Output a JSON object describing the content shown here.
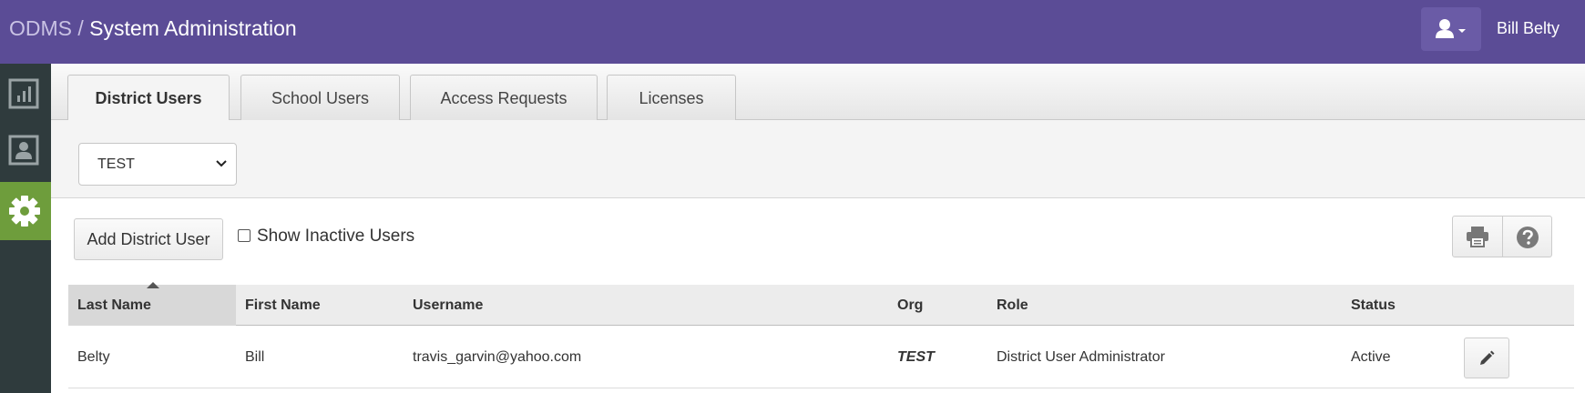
{
  "header": {
    "app": "ODMS",
    "separator": "/",
    "title": "System Administration",
    "user_menu_icon": "user-icon",
    "user_name": "Bill Belty"
  },
  "rail": {
    "items": [
      {
        "icon": "chart-icon",
        "active": false
      },
      {
        "icon": "contact-card-icon",
        "active": false
      },
      {
        "icon": "gear-icon",
        "active": true
      }
    ]
  },
  "tabs": [
    {
      "label": "District Users",
      "active": true
    },
    {
      "label": "School Users",
      "active": false
    },
    {
      "label": "Access Requests",
      "active": false
    },
    {
      "label": "Licenses",
      "active": false
    }
  ],
  "filter": {
    "district_selected": "TEST"
  },
  "toolbar": {
    "add_label": "Add District User",
    "show_inactive_label": "Show Inactive Users",
    "show_inactive_checked": false,
    "print_icon": "print-icon",
    "help_icon": "help-icon"
  },
  "table": {
    "columns": [
      "Last Name",
      "First Name",
      "Username",
      "Org",
      "Role",
      "Status"
    ],
    "sorted_column": "Last Name",
    "rows": [
      {
        "last_name": "Belty",
        "first_name": "Bill",
        "username": "travis_garvin@yahoo.com",
        "org": "TEST",
        "role": "District User Administrator",
        "status": "Active"
      }
    ]
  },
  "colors": {
    "header": "#5b4c96",
    "rail": "#2f3b3d",
    "rail_active": "#6e9d3c"
  }
}
